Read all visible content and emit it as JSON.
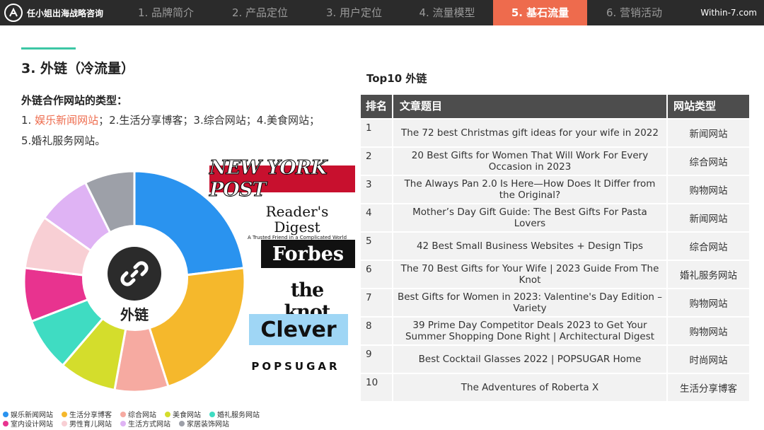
{
  "header": {
    "brand": "任小姐出海战略咨询",
    "site": "Within-7.com",
    "tabs": [
      {
        "label": "1. 品牌简介",
        "active": false
      },
      {
        "label": "2. 产品定位",
        "active": false
      },
      {
        "label": "3. 用户定位",
        "active": false
      },
      {
        "label": "4. 流量模型",
        "active": false
      },
      {
        "label": "5. 基石流量",
        "active": true
      },
      {
        "label": "6. 营销活动",
        "active": false
      }
    ]
  },
  "section": {
    "title": "3. 外链（冷流量）",
    "types_heading": "外链合作网站的类型：",
    "types_line1_prefix": "1. ",
    "types_line1_highlight": "娱乐新闻网站",
    "types_line1_rest": "；2.生活分享博客；3.综合网站；4.美食网站；",
    "types_line2": "5.婚礼服务网站。"
  },
  "donut": {
    "center_label": "外链",
    "center_icon": "link-icon",
    "slices": [
      {
        "name": "娱乐新闻网站",
        "value": 22,
        "color": "#2a93ef"
      },
      {
        "name": "生活分享博客",
        "value": 21,
        "color": "#f5b82c"
      },
      {
        "name": "综合网站",
        "value": 7.5,
        "color": "#f6aaa1"
      },
      {
        "name": "美食网站",
        "value": 8,
        "color": "#d4dd2c"
      },
      {
        "name": "婚礼服务网站",
        "value": 7.5,
        "color": "#3fdcc2"
      },
      {
        "name": "室内设计网站",
        "value": 7.5,
        "color": "#e8338f"
      },
      {
        "name": "男性育儿网站",
        "value": 7.5,
        "color": "#f8cfd4"
      },
      {
        "name": "生活方式网站",
        "value": 7.5,
        "color": "#dfb3f4"
      },
      {
        "name": "家居装饰网站",
        "value": 7,
        "color": "#9da0a8"
      }
    ]
  },
  "logos": {
    "nyp": "NEW YORK POST",
    "rd_main": "Reader's Digest",
    "rd_tag": "A Trusted Friend in a Complicated World",
    "forbes": "Forbes",
    "knot": "the knot",
    "clever": "Clever",
    "popsugar": "POPSUGAR"
  },
  "table": {
    "title": "Top10 外链",
    "headers": [
      "排名",
      "文章题目",
      "网站类型"
    ],
    "rows": [
      {
        "rank": "1",
        "title": "The 72 best Christmas gift ideas for your wife in 2022",
        "type": "新闻网站"
      },
      {
        "rank": "2",
        "title": "20 Best Gifts for Women That Will Work For Every Occasion in 2023",
        "type": "综合网站"
      },
      {
        "rank": "3",
        "title": "The Always Pan 2.0 Is Here—How Does It Differ from the Original?",
        "type": "购物网站"
      },
      {
        "rank": "4",
        "title": "Mother’s Day Gift Guide: The Best Gifts For Pasta Lovers",
        "type": "新闻网站"
      },
      {
        "rank": "5",
        "title": "42 Best Small Business Websites + Design Tips",
        "type": "综合网站"
      },
      {
        "rank": "6",
        "title": "The 70 Best Gifts for Your Wife | 2023 Guide From The Knot",
        "type": "婚礼服务网站"
      },
      {
        "rank": "7",
        "title": "Best Gifts for Women in 2023: Valentine's Day Edition – Variety",
        "type": "购物网站"
      },
      {
        "rank": "8",
        "title": "39 Prime Day Competitor Deals 2023 to Get Your Summer Shopping Done Right | Architectural Digest",
        "type": "购物网站"
      },
      {
        "rank": "9",
        "title": "Best Cocktail Glasses 2022 | POPSUGAR Home",
        "type": "时尚网站"
      },
      {
        "rank": "10",
        "title": "The Adventures of Roberta X",
        "type": "生活分享博客"
      }
    ]
  }
}
